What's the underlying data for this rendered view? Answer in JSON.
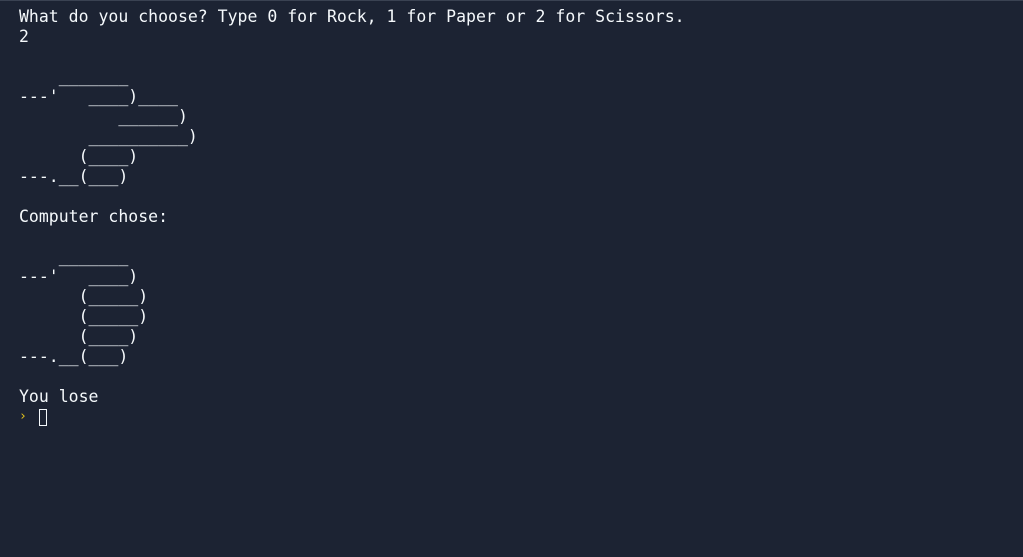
{
  "terminal": {
    "lines": [
      "What do you choose? Type 0 for Rock, 1 for Paper or 2 for Scissors.",
      "2",
      "",
      "    _______",
      "---'   ____)____",
      "          ______)",
      "       __________)",
      "      (____)",
      "---.__(___)",
      "",
      "Computer chose:",
      "",
      "    _______",
      "---'   ____)",
      "      (_____)",
      "      (_____)",
      "      (____)",
      "---.__(___)",
      "",
      "You lose"
    ],
    "prompt_symbol": "›",
    "prompt_icon": "chevron-right-icon",
    "colors": {
      "background": "#1c2333",
      "text": "#f5f9fc",
      "prompt": "#e4c31c"
    }
  }
}
